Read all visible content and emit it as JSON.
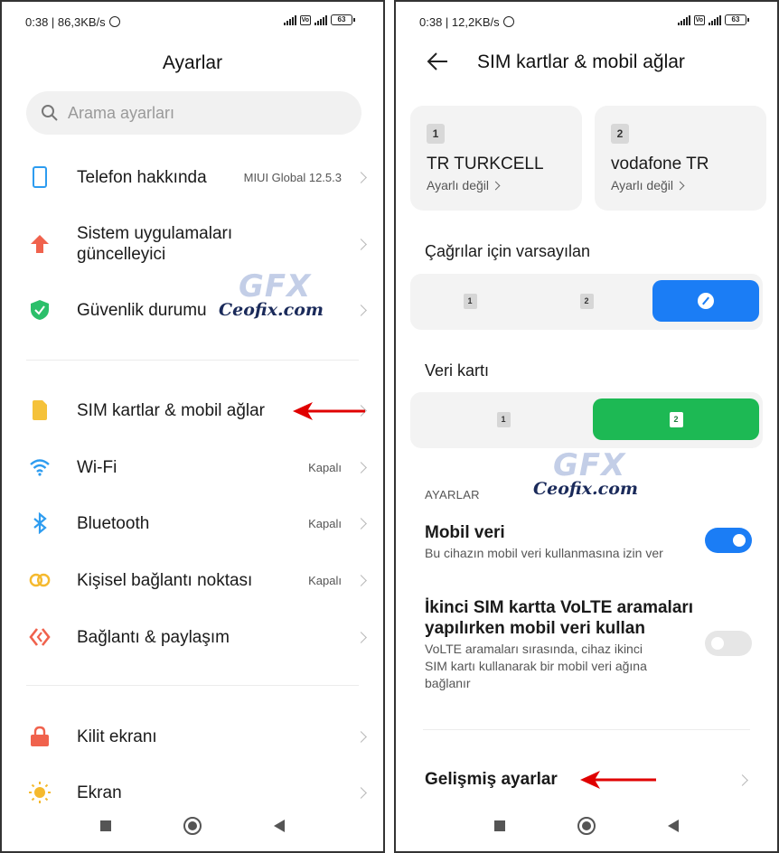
{
  "left": {
    "status": {
      "time": "0:38 | 86,3KB/s",
      "battery": "63"
    },
    "title": "Ayarlar",
    "search": {
      "placeholder": "Arama ayarları"
    },
    "items": [
      {
        "label": "Telefon hakkında",
        "value": "MIUI Global 12.5.3",
        "icon": "phone-icon",
        "color": "#2d9cf0"
      },
      {
        "label": "Sistem uygulamaları güncelleyici",
        "value": "",
        "icon": "update-arrow-icon",
        "color": "#f0624d"
      },
      {
        "label": "Güvenlik durumu",
        "value": "",
        "icon": "shield-check-icon",
        "color": "#2bbf6a"
      },
      {
        "label": "SIM kartlar & mobil ağlar",
        "value": "",
        "icon": "sim-icon",
        "color": "#f5c23a"
      },
      {
        "label": "Wi-Fi",
        "value": "Kapalı",
        "icon": "wifi-icon",
        "color": "#2d9cf0"
      },
      {
        "label": "Bluetooth",
        "value": "Kapalı",
        "icon": "bluetooth-icon",
        "color": "#2d9cf0"
      },
      {
        "label": "Kişisel bağlantı noktası",
        "value": "Kapalı",
        "icon": "hotspot-icon",
        "color": "#f5b92e"
      },
      {
        "label": "Bağlantı & paylaşım",
        "value": "",
        "icon": "connection-share-icon",
        "color": "#f0624d"
      },
      {
        "label": "Kilit ekranı",
        "value": "",
        "icon": "lock-icon",
        "color": "#f0624d"
      },
      {
        "label": "Ekran",
        "value": "",
        "icon": "sun-icon",
        "color": "#f5b92e"
      }
    ]
  },
  "right": {
    "status": {
      "time": "0:38 | 12,2KB/s",
      "battery": "63"
    },
    "title": "SIM kartlar & mobil ağlar",
    "sims": [
      {
        "slot": "1",
        "operator": "TR TURKCELL",
        "status": "Ayarlı değil"
      },
      {
        "slot": "2",
        "operator": "vodafone TR",
        "status": "Ayarlı değil"
      }
    ],
    "calls_default": {
      "label": "Çağrılar için varsayılan",
      "options": [
        "1",
        "2"
      ]
    },
    "data_card": {
      "label": "Veri kartı",
      "options": [
        "1",
        "2"
      ]
    },
    "section": "AYARLAR",
    "mobile_data": {
      "title": "Mobil veri",
      "subtitle": "Bu cihazın mobil veri kullanmasına izin ver",
      "on": true
    },
    "volte": {
      "title1": "İkinci SIM kartta VoLTE aramaları",
      "title2": "yapılırken mobil veri kullan",
      "sub1": "VoLTE aramaları sırasında, cihaz ikinci",
      "sub2": "SIM kartı kullanarak bir mobil veri ağına",
      "sub3": "bağlanır",
      "on": false
    },
    "advanced": "Gelişmiş ayarlar"
  },
  "watermark": {
    "brand": "Ceofix.com",
    "logo": "GFX"
  }
}
